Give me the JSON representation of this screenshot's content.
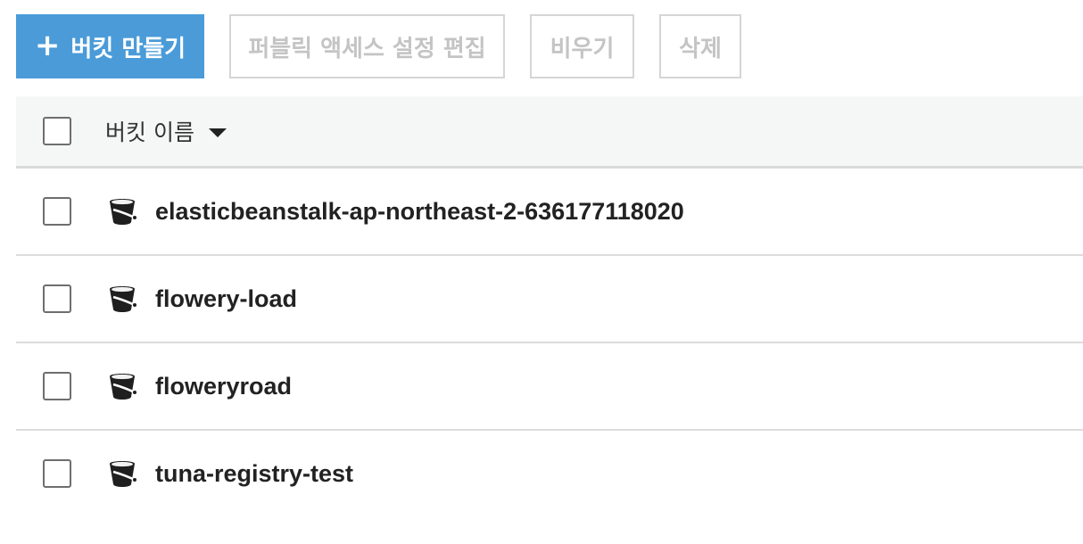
{
  "toolbar": {
    "create_bucket_label": "버킷 만들기",
    "edit_public_access_label": "퍼블릭 액세스 설정 편집",
    "empty_label": "비우기",
    "delete_label": "삭제"
  },
  "table": {
    "header": {
      "bucket_name_label": "버킷 이름",
      "sort_icon": "caret-down-icon"
    },
    "rows": [
      {
        "name": "elasticbeanstalk-ap-northeast-2-636177118020",
        "icon": "bucket-icon",
        "checked": false
      },
      {
        "name": "flowery-load",
        "icon": "bucket-icon",
        "checked": false
      },
      {
        "name": "floweryroad",
        "icon": "bucket-icon",
        "checked": false
      },
      {
        "name": "tuna-registry-test",
        "icon": "bucket-icon",
        "checked": false
      }
    ]
  },
  "colors": {
    "primary_button": "#4a9bd8",
    "disabled_text": "#c4c4c4",
    "header_background": "#f5f6f6"
  }
}
